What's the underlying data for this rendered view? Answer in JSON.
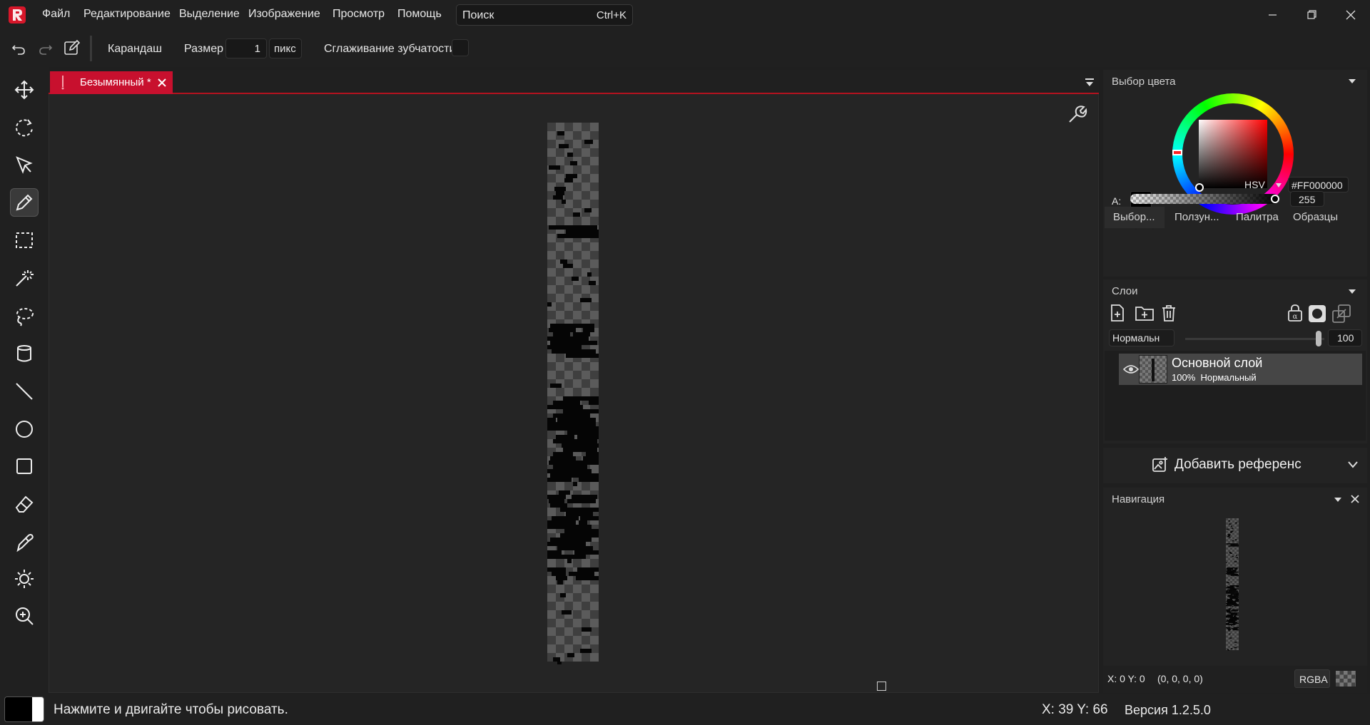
{
  "app": {
    "accent": "#c8102e"
  },
  "menu": {
    "items": [
      "Файл",
      "Редактирование",
      "Выделение",
      "Изображение",
      "Просмотр",
      "Помощь"
    ]
  },
  "search": {
    "placeholder": "Поиск",
    "shortcut": "Ctrl+K"
  },
  "tool_options": {
    "tool_name": "Карандаш",
    "size_label": "Размер",
    "size_value": "1",
    "size_unit": "пикс",
    "antialias_label": "Сглаживание зубчатости"
  },
  "toolbox": {
    "tools": [
      "move-icon",
      "rotate-icon",
      "select-arrow-icon",
      "pencil-icon",
      "rect-select-icon",
      "magic-wand-icon",
      "lasso-icon",
      "bucket-icon",
      "line-icon",
      "ellipse-icon",
      "rectangle-icon",
      "eraser-icon",
      "color-picker-icon",
      "brightness-icon",
      "zoom-icon"
    ],
    "active": "pencil-icon"
  },
  "document": {
    "tab_title": "Безымянный *"
  },
  "color_picker": {
    "title": "Выбор цвета",
    "mode": "HSV",
    "hex": "#FF000000",
    "alpha_label": "A:",
    "alpha_value": "255",
    "primary": "#000000",
    "secondary": "#ffffff",
    "tabs": [
      "Выбор...",
      "Ползун...",
      "Палитра",
      "Образцы"
    ]
  },
  "layers": {
    "title": "Слои",
    "blend_mode": "Нормальн",
    "opacity": "100",
    "items": [
      {
        "name": "Основной слой",
        "opacity": "100%",
        "mode": "Нормальный"
      }
    ]
  },
  "reference": {
    "label": "Добавить референс"
  },
  "navigation": {
    "title": "Навигация",
    "cursor_info": "X: 0 Y: 0",
    "pixel_value": "(0, 0, 0, 0)",
    "channel_mode": "RGBA"
  },
  "status": {
    "message": "Нажмите и двигайте чтобы рисовать.",
    "coords": "X: 39 Y: 66",
    "version": "Версия 1.2.5.0"
  }
}
